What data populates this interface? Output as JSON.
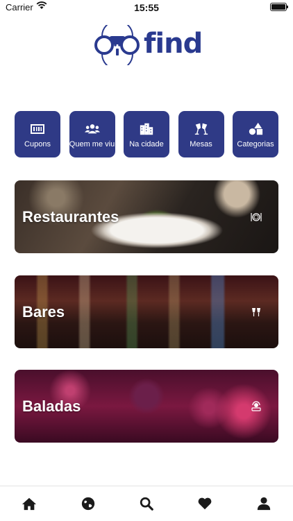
{
  "status": {
    "carrier": "Carrier",
    "time": "15:55"
  },
  "logo": {
    "text": "find",
    "color": "#2a3a8f"
  },
  "quick_actions": [
    {
      "label": "Cupons",
      "icon": "ticket-icon"
    },
    {
      "label": "Quem me viu",
      "icon": "users-icon"
    },
    {
      "label": "Na cidade",
      "icon": "city-icon"
    },
    {
      "label": "Mesas",
      "icon": "cheers-icon"
    },
    {
      "label": "Categorias",
      "icon": "shapes-icon"
    }
  ],
  "categories": [
    {
      "label": "Restaurantes",
      "icon": "plate-cutlery-icon"
    },
    {
      "label": "Bares",
      "icon": "wine-glasses-icon"
    },
    {
      "label": "Baladas",
      "icon": "dj-icon"
    }
  ],
  "tabs": [
    {
      "name": "home",
      "icon": "home-icon"
    },
    {
      "name": "explore",
      "icon": "globe-icon"
    },
    {
      "name": "search",
      "icon": "search-icon"
    },
    {
      "name": "favorites",
      "icon": "heart-icon"
    },
    {
      "name": "profile",
      "icon": "user-icon"
    }
  ],
  "colors": {
    "primary": "#2f3a86",
    "tab_icon": "#1b1b1b"
  }
}
